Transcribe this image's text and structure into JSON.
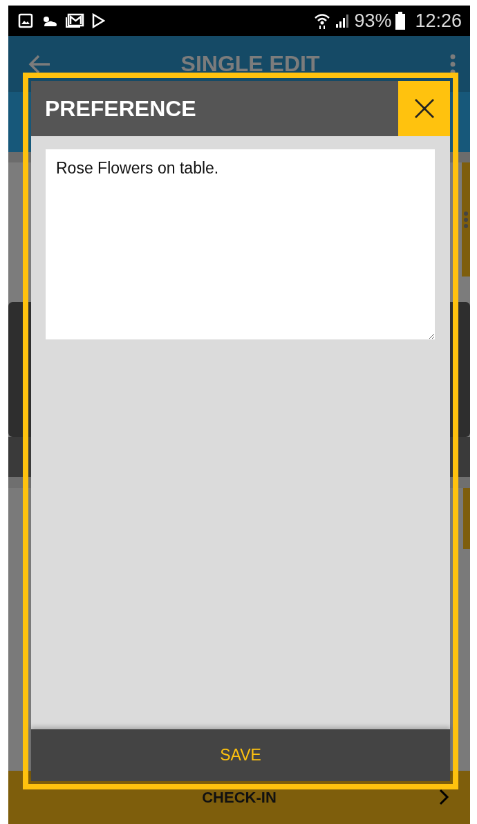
{
  "status_bar": {
    "battery": "93%",
    "time": "12:26"
  },
  "app_bar": {
    "title": "SINGLE EDIT"
  },
  "dialog": {
    "title": "PREFERENCE",
    "note": {
      "value": "Rose Flowers on table."
    },
    "save_button": "SAVE"
  },
  "bottom_bar": {
    "label": "CHECK-IN"
  }
}
